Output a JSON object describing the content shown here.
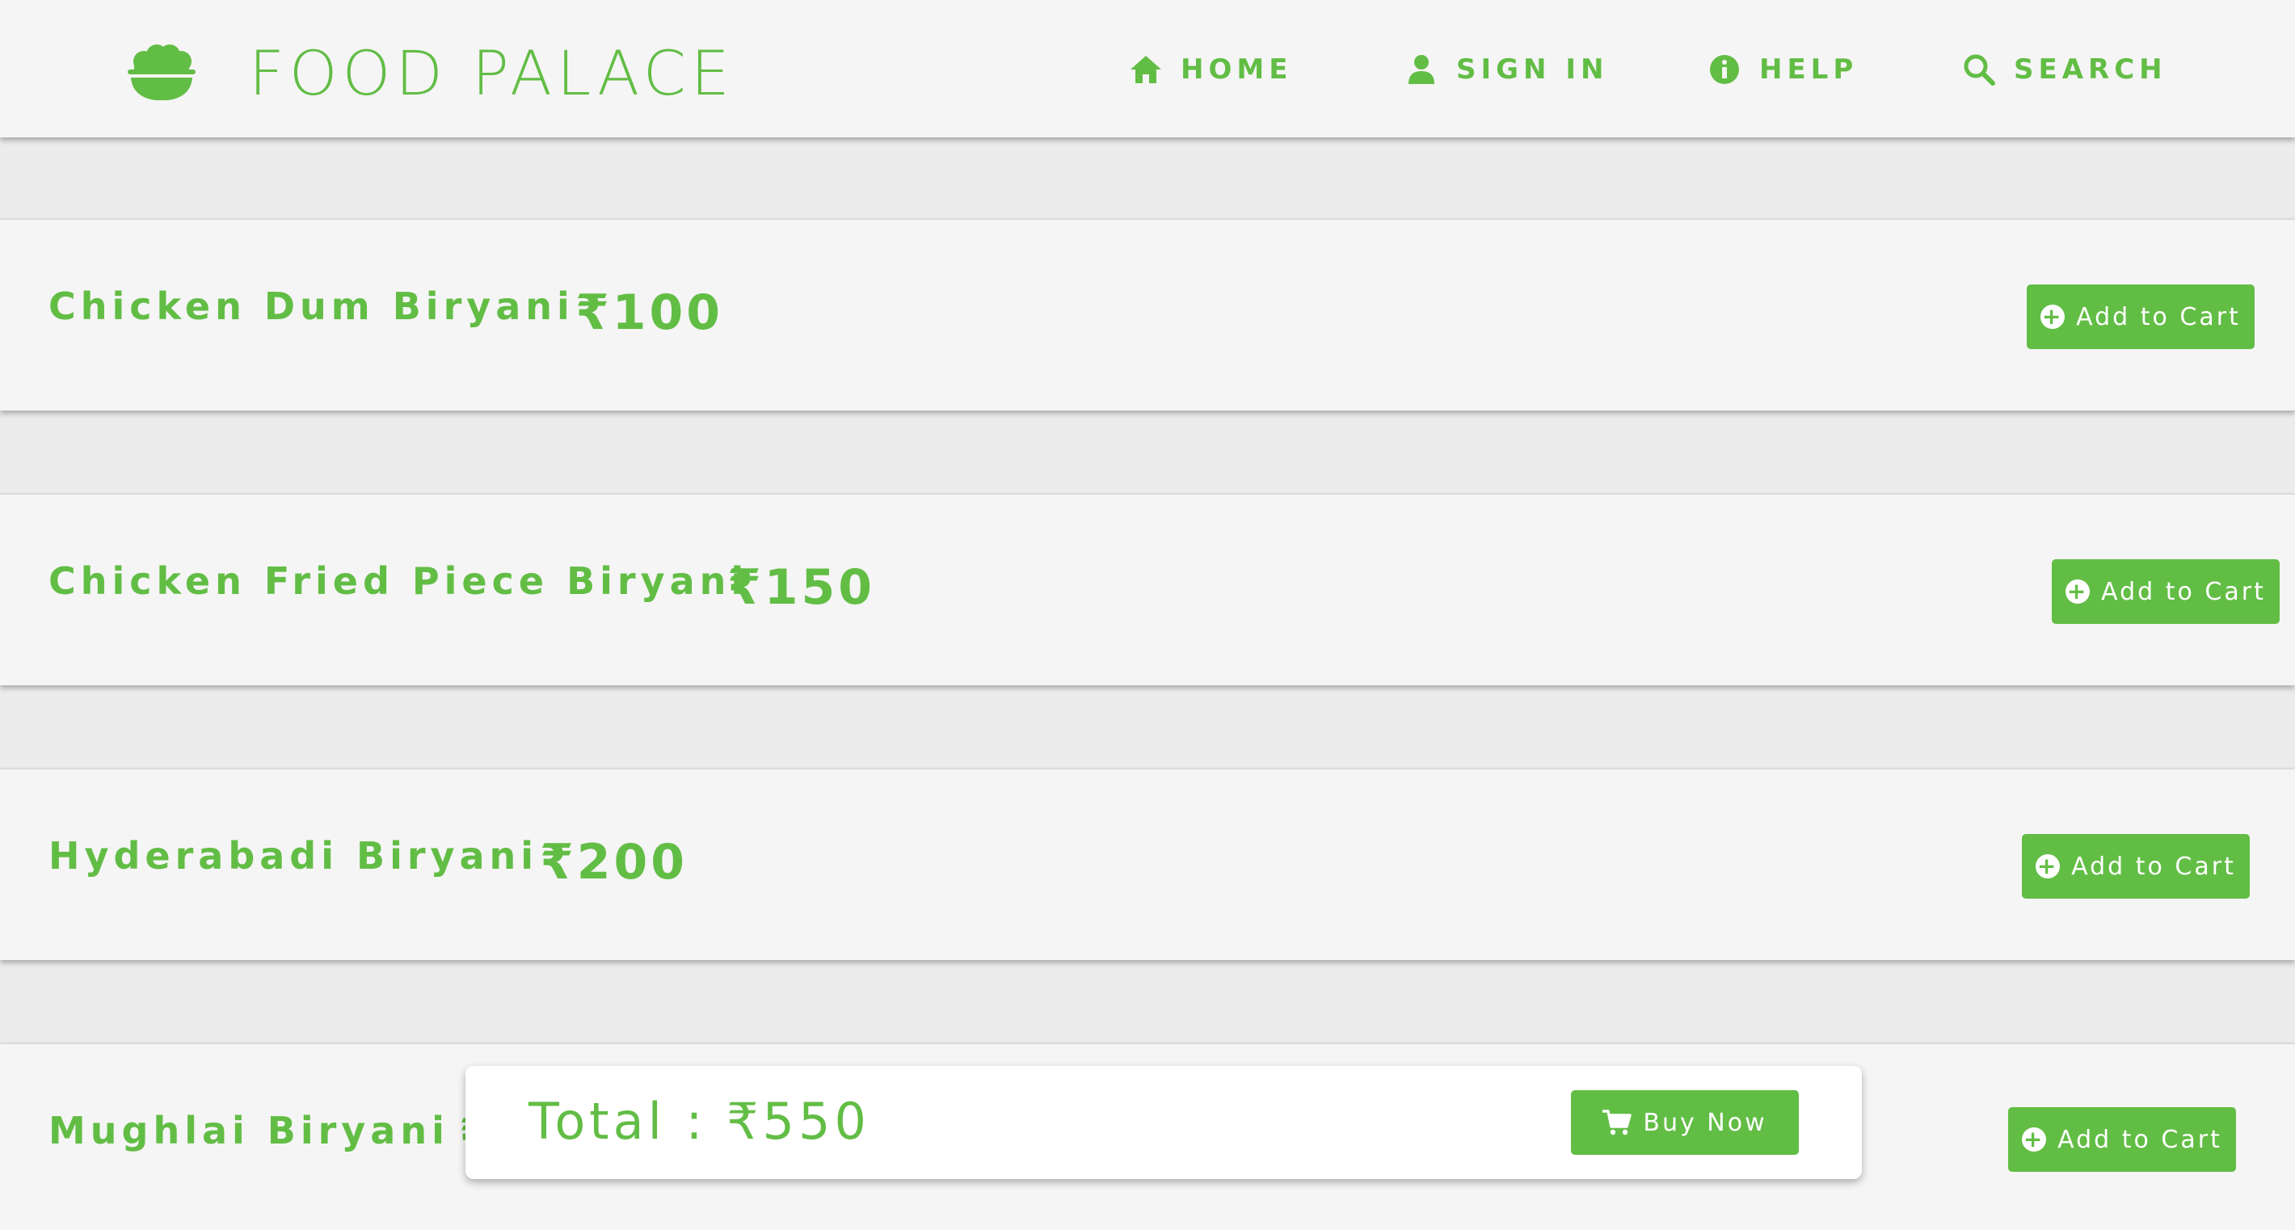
{
  "app": {
    "brand_name": "FOOD PALACE",
    "accent_color": "#62bd45",
    "logo_icon": "rice-bowl-icon"
  },
  "nav": {
    "home": {
      "label": "HOME",
      "icon": "home-icon"
    },
    "sign_in": {
      "label": "SIGN IN",
      "icon": "user-icon"
    },
    "help": {
      "label": "HELP",
      "icon": "info-icon"
    },
    "search": {
      "label": "SEARCH",
      "icon": "search-icon"
    }
  },
  "menu": {
    "add_label": "Add to Cart",
    "items": [
      {
        "name": "Chicken Dum Biryani",
        "price": "₹100"
      },
      {
        "name": "Chicken Fried Piece Biryani",
        "price": "₹150"
      },
      {
        "name": "Hyderabadi Biryani",
        "price": "₹200"
      },
      {
        "name": "Mughlai Biryani",
        "price": "₹"
      }
    ]
  },
  "cart": {
    "total": "Total : ₹550",
    "buy_label": "Buy Now",
    "buy_icon": "cart-icon"
  }
}
